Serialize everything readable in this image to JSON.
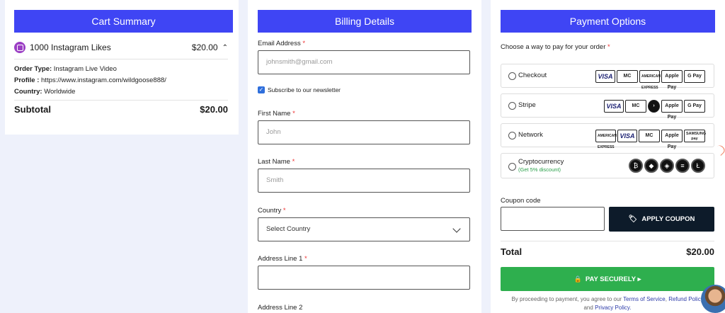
{
  "cart": {
    "title": "Cart Summary",
    "product": "1000 Instagram Likes",
    "price": "$20.00",
    "order_type_label": "Order Type:",
    "order_type": "Instagram Live Video",
    "profile_label": "Profile :",
    "profile": "https://www.instagram.com/wildgoose888/",
    "country_label": "Country:",
    "country": "Worldwide",
    "subtotal_label": "Subtotal",
    "subtotal": "$20.00"
  },
  "billing": {
    "title": "Billing Details",
    "email_label": "Email Address",
    "email_placeholder": "johnsmith@gmail.com",
    "newsletter": "Subscribe to our newsletter",
    "first_label": "First Name",
    "first_placeholder": "John",
    "last_label": "Last Name",
    "last_placeholder": "Smith",
    "country_label": "Country",
    "country_value": "Select Country",
    "addr1_label": "Address Line 1",
    "addr2_label": "Address Line 2",
    "required_mark": "*"
  },
  "payment": {
    "title": "Payment Options",
    "choose": "Choose a way to pay for your order",
    "options": [
      {
        "name": "Checkout",
        "badges": [
          "VISA",
          "MasterCard",
          "AMERICAN EXPRESS",
          "Apple Pay",
          "G Pay"
        ]
      },
      {
        "name": "Stripe",
        "badges": [
          "VISA",
          "MasterCard",
          "arrow",
          "Apple Pay",
          "G Pay"
        ]
      },
      {
        "name": "Network",
        "badges": [
          "AMERICAN EXPRESS",
          "VISA",
          "MasterCard",
          "Apple Pay",
          "SAMSUNG pay"
        ]
      },
      {
        "name": "Cryptocurrency",
        "sub": "(Get 5% discount)",
        "badges": [
          "bitcoin",
          "ethereum",
          "bnb",
          "solana",
          "litecoin"
        ]
      }
    ],
    "coupon_label": "Coupon code",
    "coupon_button": "APPLY COUPON",
    "total_label": "Total",
    "total": "$20.00",
    "pay_button": "PAY SECURELY ▸",
    "legal_prefix": "By proceeding to payment, you agree to our",
    "terms": "Terms of Service",
    "refund": "Refund Policy",
    "legal_and": "and",
    "privacy": "Privacy Policy."
  }
}
